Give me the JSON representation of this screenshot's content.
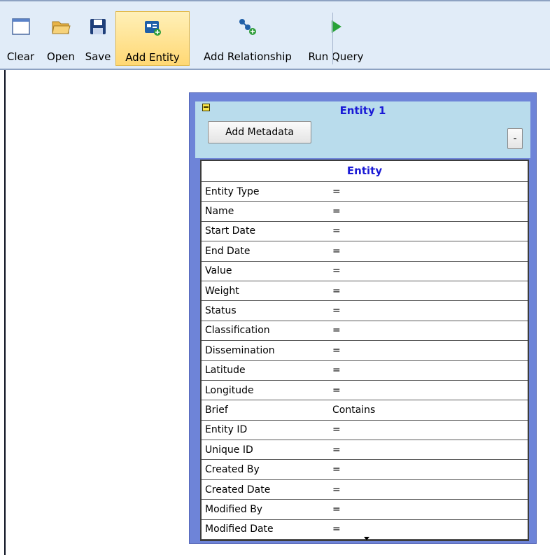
{
  "toolbar": {
    "buttons": [
      {
        "label": "Clear",
        "icon": "clear-icon"
      },
      {
        "label": "Open",
        "icon": "folder-open-icon"
      },
      {
        "label": "Save",
        "icon": "floppy-disk-icon"
      },
      {
        "label": "Add Entity",
        "icon": "add-entity-icon",
        "active": true
      },
      {
        "label": "Add Relationship",
        "icon": "add-relationship-icon"
      },
      {
        "label": "Run Query",
        "icon": "play-icon"
      }
    ]
  },
  "entity_panel": {
    "title": "Entity 1",
    "add_metadata_label": "Add Metadata",
    "minus_label": "-",
    "grid_header": "Entity",
    "rows": [
      {
        "name": "Entity Type",
        "op": "="
      },
      {
        "name": "Name",
        "op": "="
      },
      {
        "name": "Start Date",
        "op": "="
      },
      {
        "name": "End Date",
        "op": "="
      },
      {
        "name": "Value",
        "op": "="
      },
      {
        "name": "Weight",
        "op": "="
      },
      {
        "name": "Status",
        "op": "="
      },
      {
        "name": "Classification",
        "op": "="
      },
      {
        "name": "Dissemination",
        "op": "="
      },
      {
        "name": "Latitude",
        "op": "="
      },
      {
        "name": "Longitude",
        "op": "="
      },
      {
        "name": "Brief",
        "op": "Contains"
      },
      {
        "name": "Entity ID",
        "op": "="
      },
      {
        "name": "Unique ID",
        "op": "="
      },
      {
        "name": "Created By",
        "op": "="
      },
      {
        "name": "Created Date",
        "op": "="
      },
      {
        "name": "Modified By",
        "op": "="
      },
      {
        "name": "Modified Date",
        "op": "="
      }
    ]
  },
  "colors": {
    "toolbar_bg": "#e1ecf8",
    "panel_border": "#6e84d8",
    "panel_header": "#b9dcec",
    "title_text": "#1a1ad6",
    "active_button": "#ffd874"
  }
}
